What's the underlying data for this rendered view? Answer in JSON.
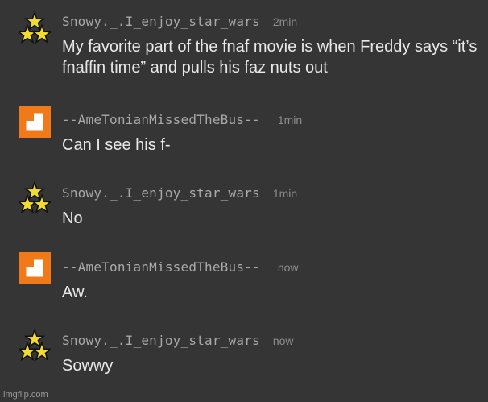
{
  "messages": [
    {
      "username": "Snowy._.I_enjoy_star_wars",
      "time": "2min",
      "avatar": "stars-avatar",
      "text": "My favorite part of the fnaf movie is when Freddy says “it’s fnaffin time” and pulls his faz nuts out"
    },
    {
      "username": "--AmeTonianMissedTheBus--",
      "time": "1min",
      "avatar": "orange-square-avatar",
      "text": "Can I see his f-"
    },
    {
      "username": "Snowy._.I_enjoy_star_wars",
      "time": "1min",
      "avatar": "stars-avatar",
      "text": "No"
    },
    {
      "username": "--AmeTonianMissedTheBus--",
      "time": "now",
      "avatar": "orange-square-avatar",
      "text": "Aw."
    },
    {
      "username": "Snowy._.I_enjoy_star_wars",
      "time": "now",
      "avatar": "stars-avatar",
      "text": "Sowwy"
    }
  ],
  "watermark": "imgflip.com",
  "colors": {
    "background": "#353535",
    "username": "#a9a9a9",
    "time": "#8d8d8d",
    "text": "#e8e8e8",
    "avatar_orange": "#f0791a",
    "star_yellow": "#f2dc2e"
  }
}
